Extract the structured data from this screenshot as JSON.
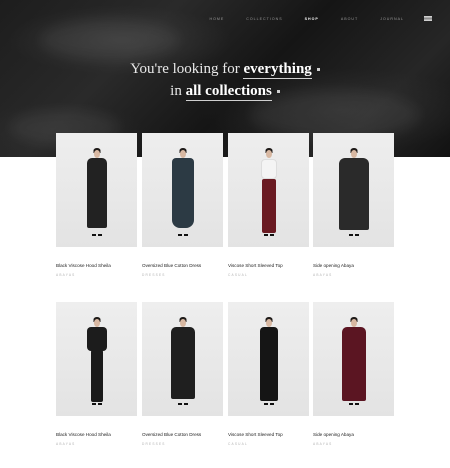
{
  "nav": {
    "items": [
      {
        "label": "HOME",
        "active": false
      },
      {
        "label": "COLLECTIONS",
        "active": false
      },
      {
        "label": "SHOP",
        "active": true
      },
      {
        "label": "ABOUT",
        "active": false
      },
      {
        "label": "JOURNAL",
        "active": false
      }
    ],
    "flag_icon": "uk-flag-icon"
  },
  "hero": {
    "line1_prefix": "You're looking for",
    "line1_emphasis": "everything",
    "line2_prefix": "in",
    "line2_emphasis": "all collections"
  },
  "products": [
    {
      "title": "Black Viscose Hood Sheila",
      "category": "ABAYAS",
      "garment": "#222222"
    },
    {
      "title": "Oversized Blue Cotton Dress",
      "category": "DRESSES",
      "garment": "#2c3a44"
    },
    {
      "title": "Viscose Short Sleeved Top",
      "category": "CASUAL",
      "garment": "#6a1a22"
    },
    {
      "title": "Side opening Abaya",
      "category": "ABAYAS",
      "garment": "#2a2a2a"
    },
    {
      "title": "Black Viscose Hood Sheila",
      "category": "ABAYAS",
      "garment": "#1c1c1c"
    },
    {
      "title": "Oversized Blue Cotton Dress",
      "category": "DRESSES",
      "garment": "#1f1f1f"
    },
    {
      "title": "Viscose Short Sleeved Top",
      "category": "CASUAL",
      "garment": "#151515"
    },
    {
      "title": "Side opening Abaya",
      "category": "ABAYAS",
      "garment": "#5b1522"
    }
  ]
}
